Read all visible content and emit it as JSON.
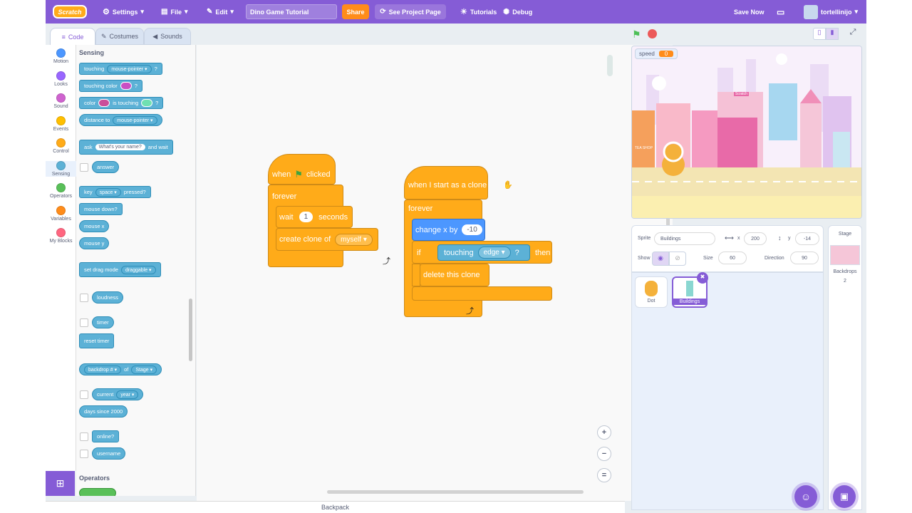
{
  "menubar": {
    "logo": "Scratch",
    "settings": "Settings",
    "file": "File",
    "edit": "Edit",
    "project_title": "Dino Game Tutorial",
    "share": "Share",
    "see_project": "See Project Page",
    "tutorials": "Tutorials",
    "debug": "Debug",
    "save_now": "Save Now",
    "username": "tortellinijo"
  },
  "tabs": {
    "code": "Code",
    "costumes": "Costumes",
    "sounds": "Sounds"
  },
  "categories": [
    "Motion",
    "Looks",
    "Sound",
    "Events",
    "Control",
    "Sensing",
    "Operators",
    "Variables",
    "My Blocks"
  ],
  "category_colors": [
    "#4c97ff",
    "#9966ff",
    "#cf63cf",
    "#ffbf00",
    "#ffab19",
    "#5cb1d6",
    "#59c059",
    "#ff8c1a",
    "#ff6680"
  ],
  "palette": {
    "sensing_heading": "Sensing",
    "touching": "touching",
    "mouse_pointer": "mouse-pointer",
    "q": "?",
    "touching_color": "touching color",
    "color": "color",
    "is_touching": "is touching",
    "distance_to": "distance to",
    "ask": "ask",
    "ask_default": "What's your name?",
    "and_wait": "and wait",
    "answer": "answer",
    "key": "key",
    "space": "space",
    "pressed": "pressed?",
    "mouse_down": "mouse down?",
    "mouse_x": "mouse x",
    "mouse_y": "mouse y",
    "set_drag_mode": "set drag mode",
    "draggable": "draggable",
    "loudness": "loudness",
    "timer": "timer",
    "reset_timer": "reset timer",
    "backdrop_num": "backdrop #",
    "of": "of",
    "stage": "Stage",
    "current": "current",
    "year": "year",
    "days_since": "days since 2000",
    "online": "online?",
    "username": "username",
    "operators_heading": "Operators"
  },
  "script1": {
    "when": "when",
    "clicked": "clicked",
    "forever": "forever",
    "wait": "wait",
    "wait_val": "1",
    "seconds": "seconds",
    "create_clone": "create clone of",
    "myself": "myself"
  },
  "script2": {
    "hat": "when I start as a clone",
    "forever": "forever",
    "change_x": "change x by",
    "change_val": "-10",
    "if": "if",
    "touching": "touching",
    "edge": "edge",
    "q": "?",
    "then": "then",
    "delete_clone": "delete this clone"
  },
  "zoom": {
    "in": "+",
    "out": "−",
    "reset": "="
  },
  "backpack": "Backpack",
  "stage": {
    "var_name": "speed",
    "var_value": "0",
    "shop1": "TEA SHOP",
    "shop2": "Scratch"
  },
  "sprite_info": {
    "sprite_label": "Sprite",
    "sprite_name": "Buildings",
    "x_label": "x",
    "x": "200",
    "y_label": "y",
    "y": "-14",
    "show_label": "Show",
    "size_label": "Size",
    "size": "60",
    "direction_label": "Direction",
    "direction": "90"
  },
  "sprites": [
    {
      "name": "Dot"
    },
    {
      "name": "Buildings"
    }
  ],
  "stage_panel": {
    "title": "Stage",
    "backdrops_label": "Backdrops",
    "backdrops_count": "2"
  }
}
